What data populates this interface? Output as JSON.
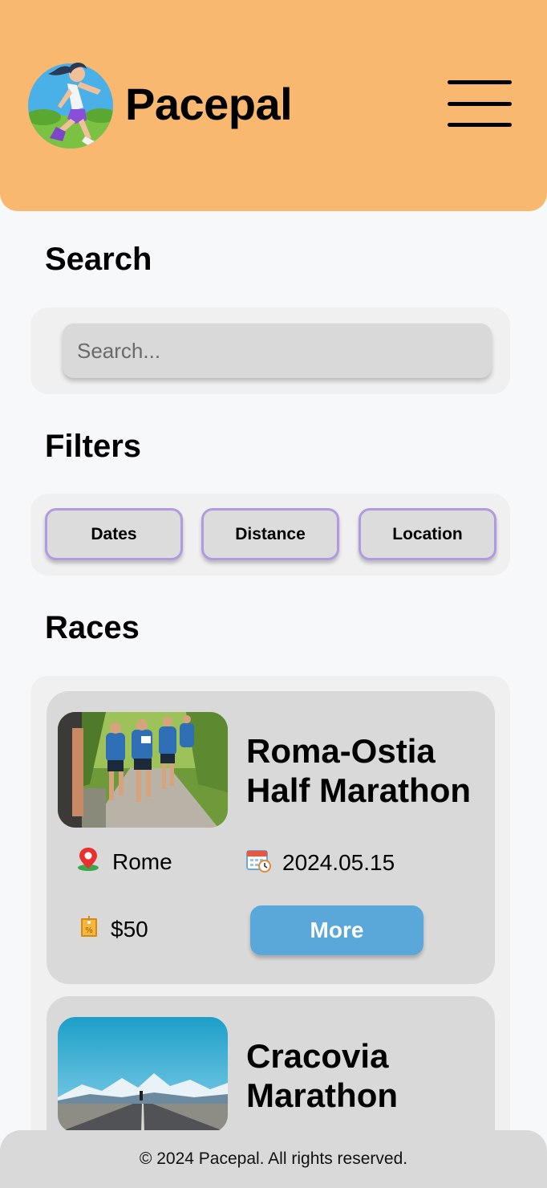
{
  "header": {
    "app_name": "Pacepal",
    "logo_icon": "runner-logo-icon",
    "menu_icon": "hamburger-menu-icon",
    "background_color": "#f8b870"
  },
  "search": {
    "title": "Search",
    "placeholder": "Search..."
  },
  "filters": {
    "title": "Filters",
    "items": [
      {
        "label": "Dates"
      },
      {
        "label": "Distance"
      },
      {
        "label": "Location"
      }
    ],
    "border_color": "#b09ae0"
  },
  "races": {
    "title": "Races",
    "items": [
      {
        "title": "Roma-Ostia Half Marathon",
        "location": "Rome",
        "date": "2024.05.15",
        "price": "$50",
        "more_label": "More",
        "location_icon": "map-pin-icon",
        "date_icon": "calendar-clock-icon",
        "price_icon": "price-tag-icon",
        "image": "runners-photo"
      },
      {
        "title": "Cracovia Marathon",
        "image": "mountain-road-photo"
      }
    ],
    "more_button_color": "#5aa8da"
  },
  "footer": {
    "text": "© 2024 Pacepal. All rights reserved."
  }
}
